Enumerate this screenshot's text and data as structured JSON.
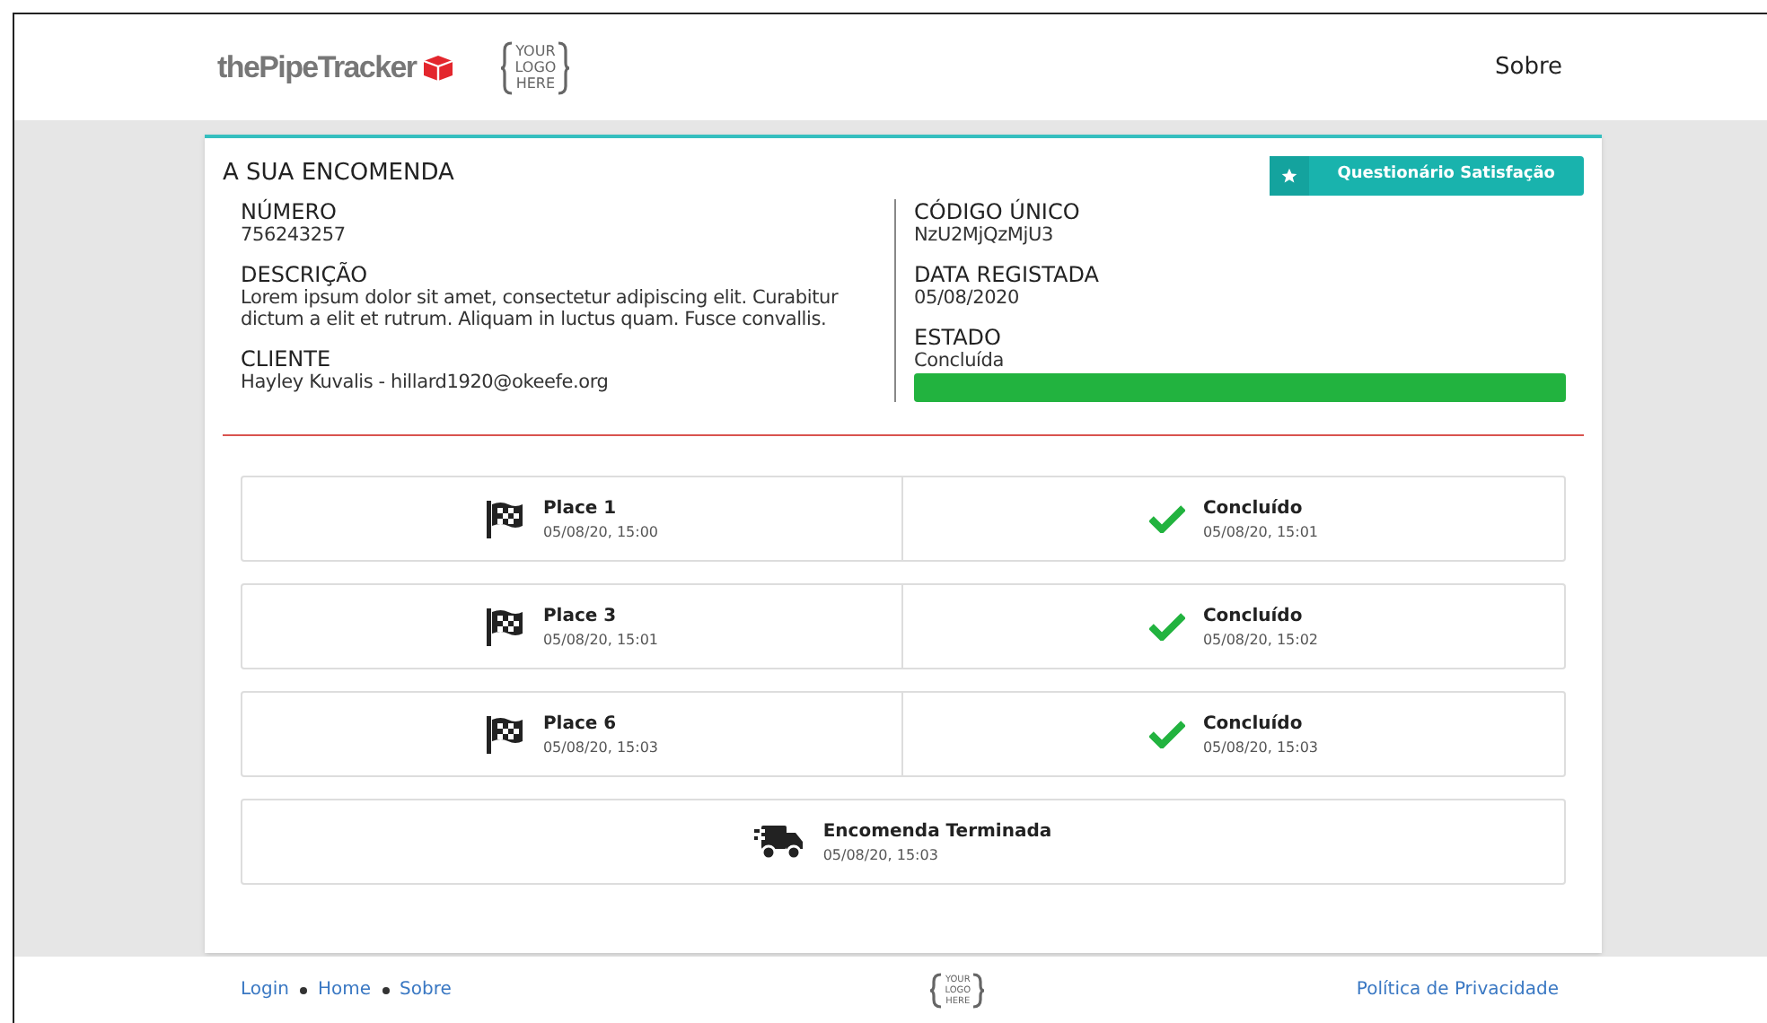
{
  "header": {
    "brand": "the**Pipe**Tracker",
    "placeholder_logo": [
      "YOUR",
      "LOGO",
      "HERE"
    ],
    "nav": [
      "Sobre"
    ]
  },
  "order": {
    "title": "A SUA ENCOMENDA",
    "survey_button": "Questionário Satisfação",
    "left_fields": [
      {
        "label": "NÚMERO",
        "value": "756243257"
      },
      {
        "label": "DESCRIÇÃO",
        "value": "Lorem ipsum dolor sit amet, consectetur adipiscing elit. Curabitur dictum a elit et rutrum. Aliquam in luctus quam. Fusce convallis."
      },
      {
        "label": "CLIENTE",
        "value": "Hayley Kuvalis - hillard1920@okeefe.org"
      }
    ],
    "right_fields": [
      {
        "label": "CÓDIGO ÚNICO",
        "value": "NzU2MjQzMjU3"
      },
      {
        "label": "DATA REGISTADA",
        "value": "05/08/2020"
      }
    ],
    "status": {
      "label": "ESTADO",
      "value": "Concluída",
      "level": 1
    }
  },
  "steps": [
    {
      "kind": "place",
      "title": "Place 1",
      "time": "05/08/20, 15:00",
      "result": {
        "title": "Concluído",
        "time": "05/08/20, 15:01"
      }
    },
    {
      "kind": "place",
      "title": "Place 3",
      "time": "05/08/20, 15:01",
      "result": {
        "title": "Concluído",
        "time": "05/08/20, 15:02"
      }
    },
    {
      "kind": "place",
      "title": "Place 6",
      "time": "05/08/20, 15:03",
      "result": {
        "title": "Concluído",
        "time": "05/08/20, 15:03"
      }
    },
    {
      "kind": "end",
      "title": "Encomenda Terminada",
      "time": "05/08/20, 15:03"
    }
  ],
  "footer": {
    "links": [
      "Login",
      "Home",
      "Sobre"
    ],
    "placeholder_logo": [
      "YOUR",
      "LOGO",
      "HERE"
    ],
    "privacy": "Política de Privacidade"
  }
}
